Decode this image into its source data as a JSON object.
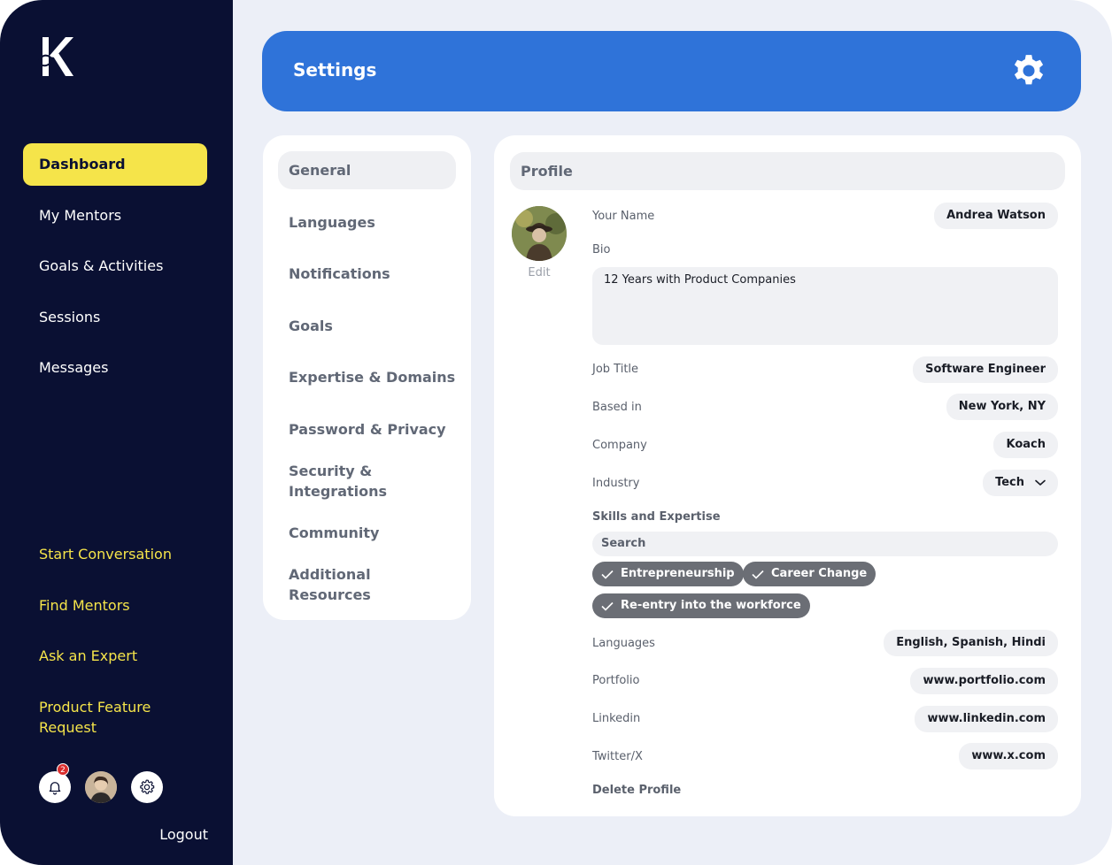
{
  "sidebar": {
    "logo_letter": "K",
    "nav": [
      {
        "label": "Dashboard",
        "active": true
      },
      {
        "label": "My Mentors"
      },
      {
        "label": "Goals & Activities"
      },
      {
        "label": "Sessions"
      },
      {
        "label": "Messages"
      }
    ],
    "links": [
      "Start Conversation",
      "Find Mentors",
      "Ask an Expert",
      "Product Feature Request"
    ],
    "notification_count": "2",
    "logout_label": "Logout"
  },
  "header": {
    "title": "Settings",
    "icon": "gear-icon"
  },
  "settings_menu": [
    {
      "label": "General",
      "active": true
    },
    {
      "label": "Languages"
    },
    {
      "label": "Notifications"
    },
    {
      "label": "Goals"
    },
    {
      "label": "Expertise & Domains"
    },
    {
      "label": "Password & Privacy"
    },
    {
      "label": "Security & Integrations"
    },
    {
      "label": "Community"
    },
    {
      "label": "Additional Resources"
    }
  ],
  "profile": {
    "title": "Profile",
    "edit_label": "Edit",
    "your_name_label": "Your Name",
    "your_name": "Andrea Watson",
    "bio_label": "Bio",
    "bio": "12 Years with Product Companies",
    "job_title_label": "Job Title",
    "job_title": "Software Engineer",
    "based_in_label": "Based in",
    "based_in": "New York, NY",
    "company_label": "Company",
    "company": "Koach",
    "industry_label": "Industry",
    "industry": "Tech",
    "skills_label": "Skills and Expertise",
    "search_placeholder": "Search",
    "skills": [
      "Entrepreneurship",
      "Career Change",
      "Re-entry into the workforce"
    ],
    "languages_label": "Languages",
    "languages": "English, Spanish, Hindi",
    "portfolio_label": "Portfolio",
    "portfolio": "www.portfolio.com",
    "linkedin_label": "Linkedin",
    "linkedin": "www.linkedin.com",
    "twitter_label": "Twitter/X",
    "twitter": "www.x.com",
    "delete_label": "Delete Profile"
  },
  "colors": {
    "sidebar_bg": "#0a1033",
    "accent_yellow": "#f5e44a",
    "header_blue": "#2f73d9",
    "tag_gray": "#6b6e75"
  }
}
